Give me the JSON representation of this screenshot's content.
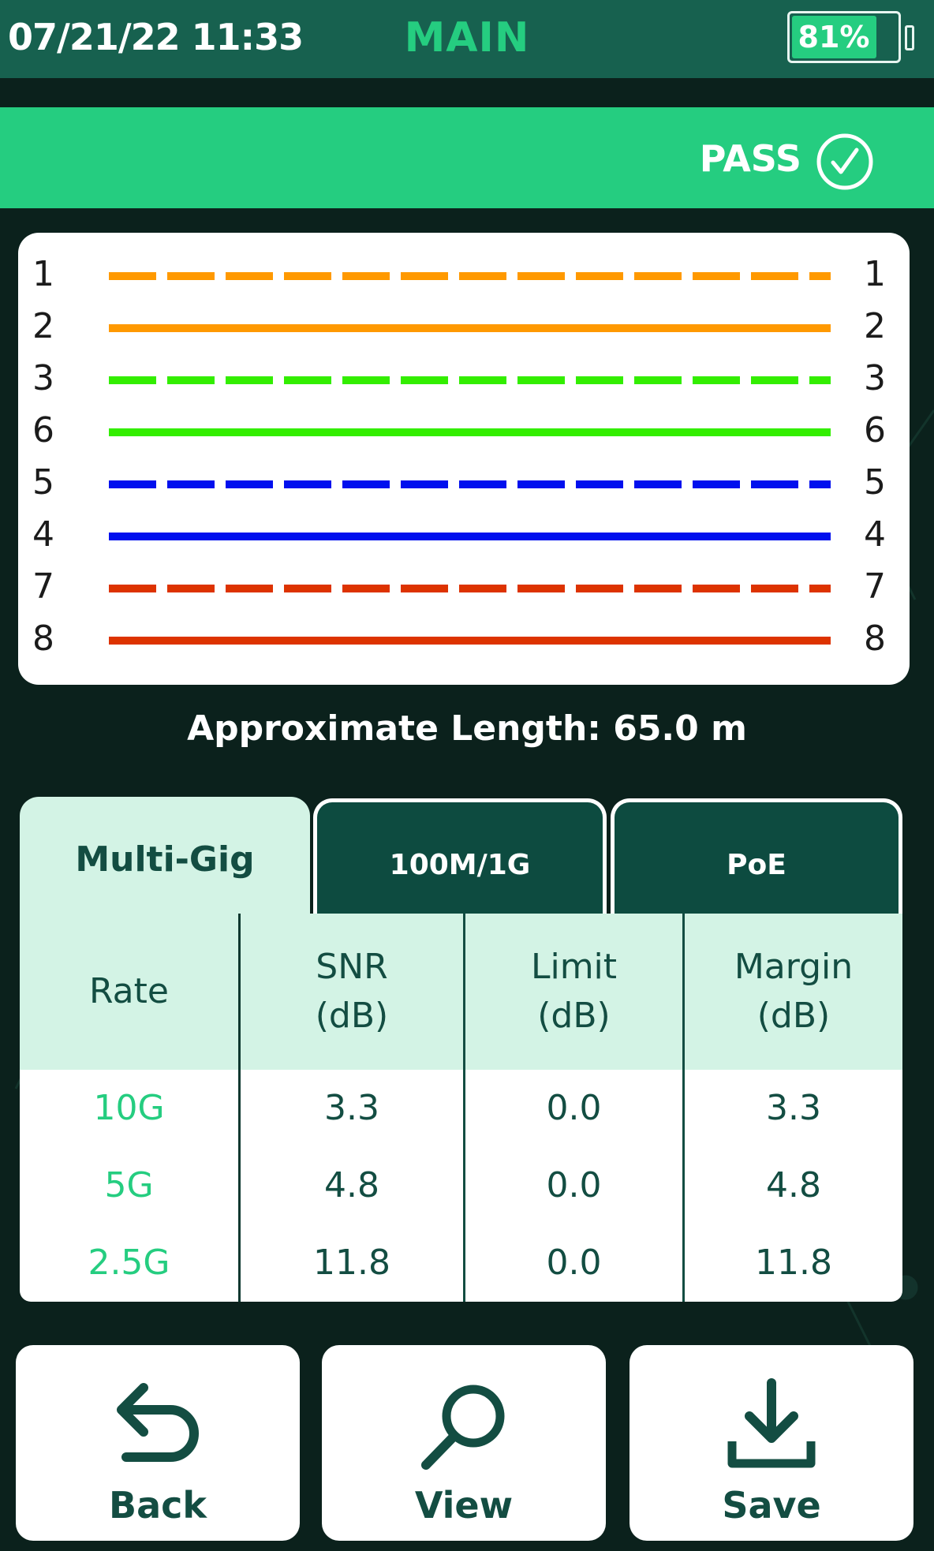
{
  "status_bar": {
    "datetime": "07/21/22 11:33",
    "title": "MAIN",
    "battery_text": "81%",
    "battery_level": 0.81
  },
  "result": {
    "label": "PASS",
    "icon": "check-circle-icon",
    "color": "#25cd80"
  },
  "wiremap": {
    "pairs": [
      {
        "left_pin": "1",
        "right_pin": "1",
        "color": "#ff9900",
        "style": "dashed"
      },
      {
        "left_pin": "2",
        "right_pin": "2",
        "color": "#ff9900",
        "style": "solid"
      },
      {
        "left_pin": "3",
        "right_pin": "3",
        "color": "#33ee00",
        "style": "dashed"
      },
      {
        "left_pin": "6",
        "right_pin": "6",
        "color": "#33ee00",
        "style": "solid"
      },
      {
        "left_pin": "5",
        "right_pin": "5",
        "color": "#0010ee",
        "style": "dashed"
      },
      {
        "left_pin": "4",
        "right_pin": "4",
        "color": "#0010ee",
        "style": "solid"
      },
      {
        "left_pin": "7",
        "right_pin": "7",
        "color": "#dd3300",
        "style": "dashed"
      },
      {
        "left_pin": "8",
        "right_pin": "8",
        "color": "#dd3300",
        "style": "solid"
      }
    ]
  },
  "length_text": "Approximate Length: 65.0 m",
  "tabs": [
    {
      "label": "Multi-Gig",
      "active": true
    },
    {
      "label": "100M/1G",
      "active": false
    },
    {
      "label": "PoE",
      "active": false
    }
  ],
  "table": {
    "headers": [
      "Rate",
      "SNR\n(dB)",
      "Limit\n(dB)",
      "Margin\n(dB)"
    ],
    "rows": [
      [
        "10G",
        "3.3",
        "0.0",
        "3.3"
      ],
      [
        "5G",
        "4.8",
        "0.0",
        "4.8"
      ],
      [
        "2.5G",
        "11.8",
        "0.0",
        "11.8"
      ]
    ]
  },
  "buttons": [
    {
      "label": "Back",
      "icon": "back-arrow-icon"
    },
    {
      "label": "View",
      "icon": "magnifier-icon"
    },
    {
      "label": "Save",
      "icon": "download-icon"
    }
  ],
  "colors": {
    "accent": "#25cd80",
    "header_bg": "#17614f",
    "dark_bg": "#0b211c",
    "tab_inactive": "#0d4b40",
    "table_header_bg": "#d3f3e5",
    "text_dark": "#134d42"
  }
}
